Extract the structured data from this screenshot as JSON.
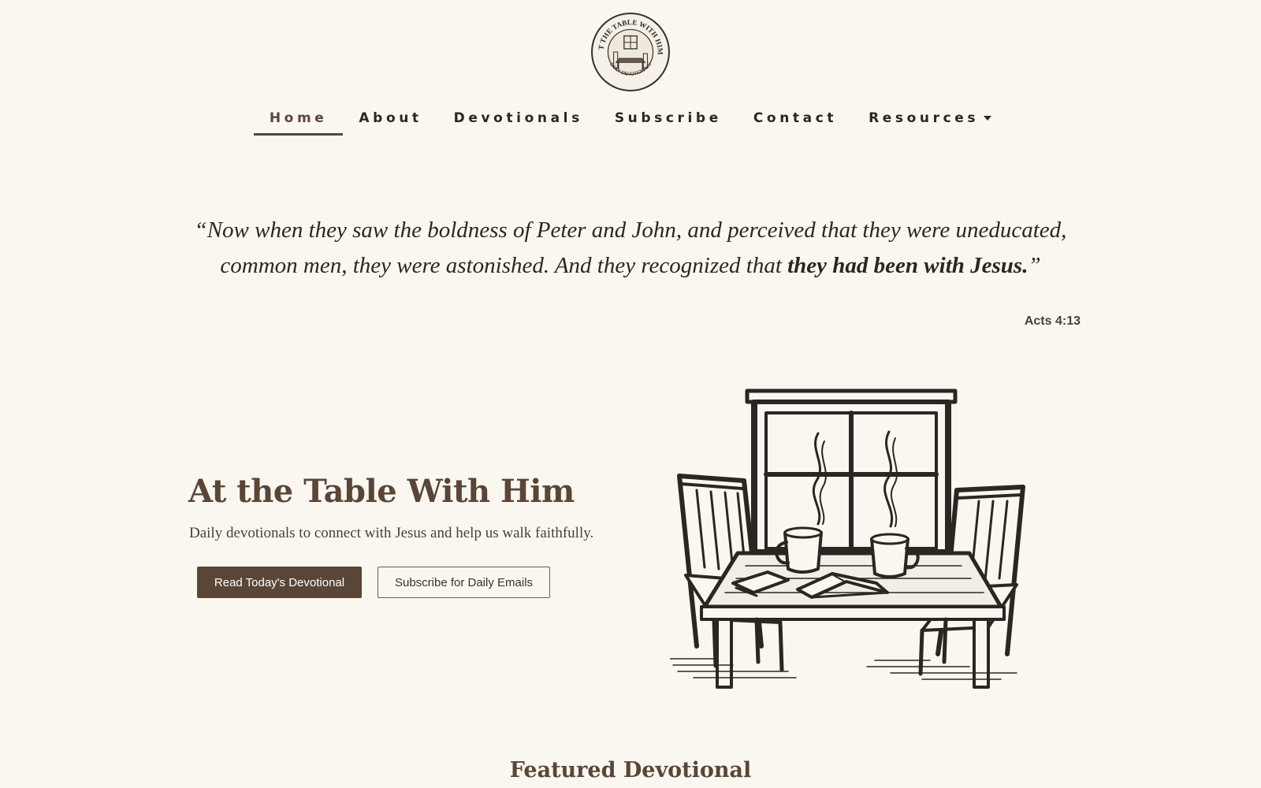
{
  "logo": {
    "ring_text_top": "AT THE TABLE WITH HIM",
    "ring_text_bottom": "DAILY DEVOTIONALS"
  },
  "nav": {
    "items": [
      {
        "label": "Home",
        "active": true
      },
      {
        "label": "About"
      },
      {
        "label": "Devotionals"
      },
      {
        "label": "Subscribe"
      },
      {
        "label": "Contact"
      },
      {
        "label": "Resources",
        "has_dropdown": true
      }
    ]
  },
  "quote": {
    "open": "“",
    "text": "Now when they saw the boldness of Peter and John, and perceived that they were uneducated, common men, they were astonished. And they recognized that ",
    "emphasis": "they had been with Jesus.",
    "close": "”",
    "reference": "Acts 4:13"
  },
  "hero": {
    "title": "At the Table With Him",
    "subtitle": "Daily devotionals to connect with Jesus and help us walk faithfully.",
    "primary_button": "Read Today's Devotional",
    "secondary_button": "Subscribe for Daily Emails"
  },
  "featured": {
    "heading": "Featured Devotional"
  },
  "colors": {
    "background": "#faf7f1",
    "accent": "#5a4636",
    "text": "#2b2621"
  }
}
